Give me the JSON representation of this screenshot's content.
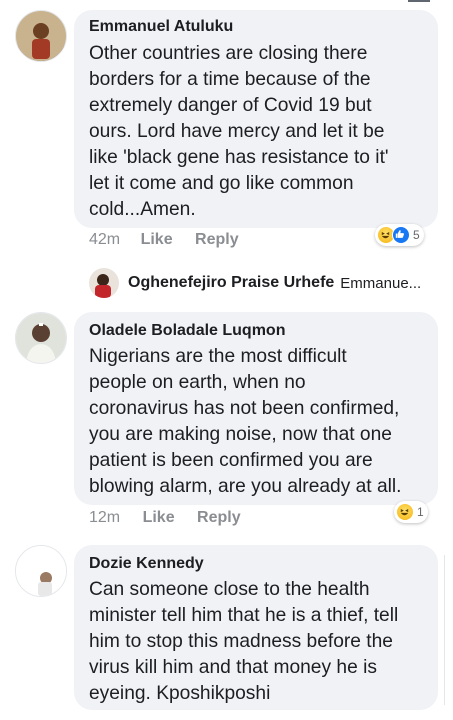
{
  "comments": [
    {
      "author": "Emmanuel Atuluku",
      "text": "Other countries are closing there\nborders for a time because of the\nextremely danger of Covid 19 but\nours. Lord have mercy and let it be\nlike 'black gene has resistance to it'\nlet it come and go like common\ncold...Amen.",
      "time": "42m",
      "like_label": "Like",
      "reply_label": "Reply",
      "reaction_count": "5"
    },
    {
      "author": "Oladele Boladale Luqmon",
      "text": "Nigerians are the most difficult\npeople on earth, when no\ncoronavirus has not been confirmed,\nyou are making noise, now that one\npatient is been confirmed you are\nblowing alarm, are you already at all.",
      "time": "12m",
      "like_label": "Like",
      "reply_label": "Reply",
      "reaction_count": "1"
    },
    {
      "author": "Dozie Kennedy",
      "text": "Can someone close to the health\nminister tell him that he is a thief, tell\nhim to stop this madness before the\nvirus kill him and that money he is\neyeing.  Kposhikposhi"
    }
  ],
  "reply_preview": {
    "author": "Oghenefejiro Praise Urhefe",
    "snippet": "Emmanue..."
  },
  "colors": {
    "bubble": "#f0f2f5",
    "meta": "#8a8d91",
    "like_blue": "#1877f2"
  }
}
